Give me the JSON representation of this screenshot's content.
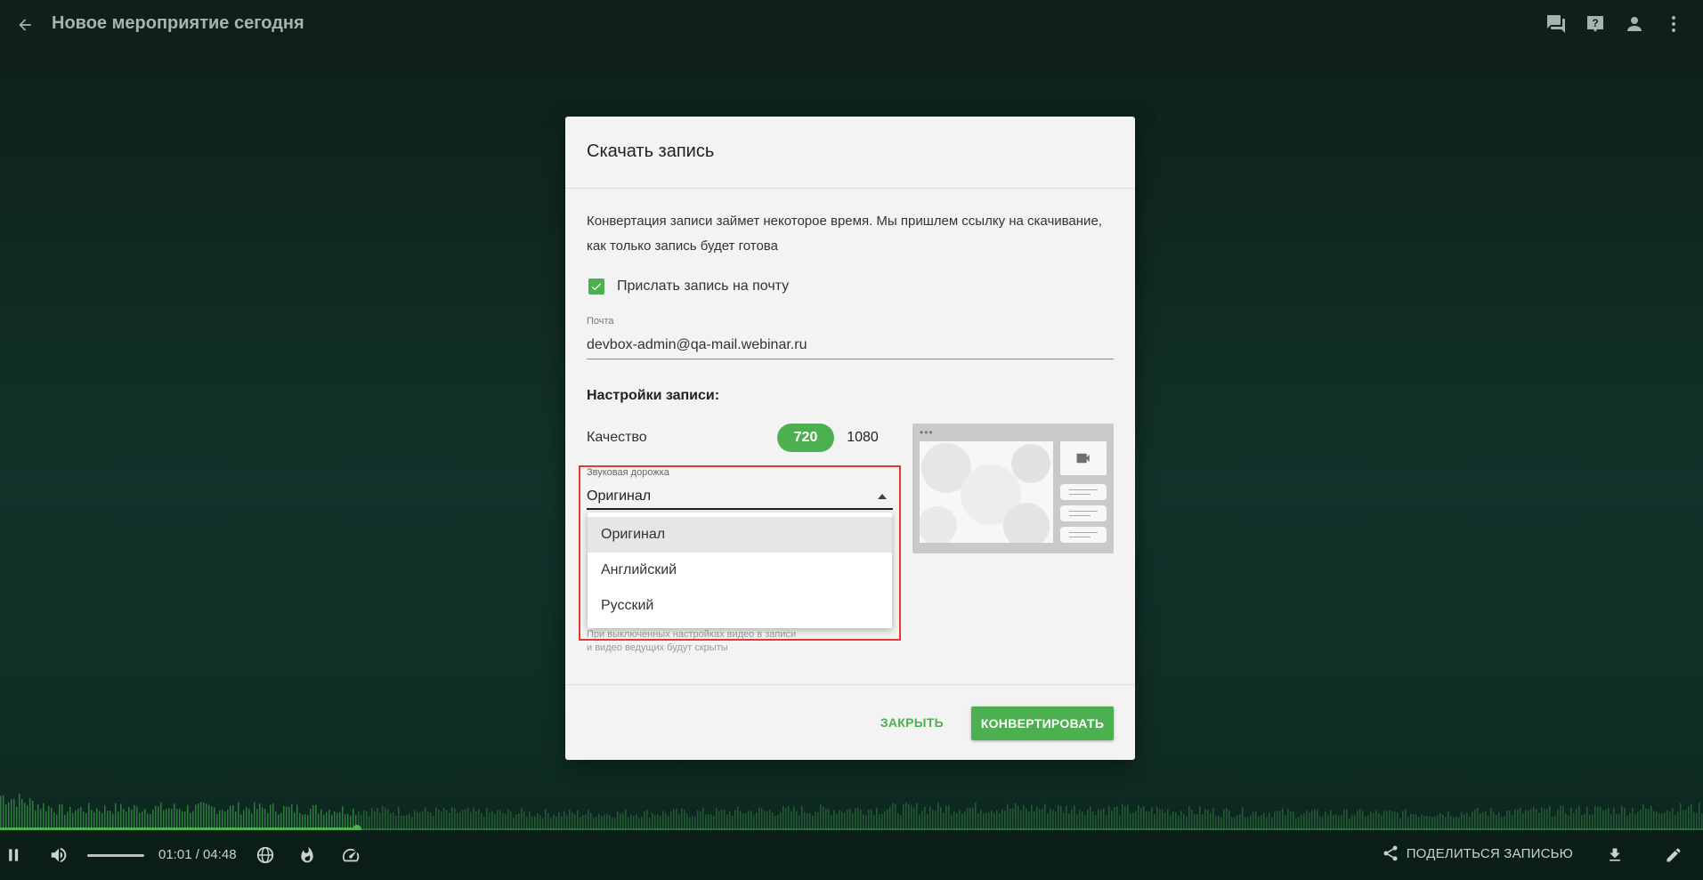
{
  "header": {
    "title": "Новое мероприятие сегодня",
    "icons": [
      "back-icon",
      "chat-icon",
      "help-icon",
      "person-icon",
      "more-vertical-icon"
    ]
  },
  "dialog": {
    "title": "Скачать запись",
    "description": "Конвертация записи займет некоторое время. Мы пришлем ссылку на скачивание, как только запись будет готова",
    "email_checkbox_label": "Прислать запись на почту",
    "email_checkbox_checked": true,
    "email_label": "Почта",
    "email_value": "devbox-admin@qa-mail.webinar.ru",
    "settings_title": "Настройки записи:",
    "quality_label": "Качество",
    "quality_options": [
      "720",
      "1080"
    ],
    "quality_selected": "720",
    "audio_label": "Звуковая дорожка",
    "audio_selected": "Оригинал",
    "audio_options": [
      "Оригинал",
      "Английский",
      "Русский"
    ],
    "hint_line1": "При выключенных настройках видео в записи",
    "hint_line2": "и видео ведущих будут скрыты",
    "close_label": "ЗАКРЫТЬ",
    "convert_label": "КОНВЕРТИРОВАТЬ"
  },
  "player": {
    "time": "01:01 / 04:48",
    "share_label": "ПОДЕЛИТЬСЯ ЗАПИСЬЮ",
    "icons": [
      "pause-icon",
      "volume-icon",
      "globe-icon",
      "fire-icon",
      "speed-icon",
      "share-icon",
      "download-icon",
      "edit-icon"
    ]
  },
  "colors": {
    "accent": "#4caf50",
    "highlight_border": "#e53935",
    "background": "#0f2620"
  }
}
